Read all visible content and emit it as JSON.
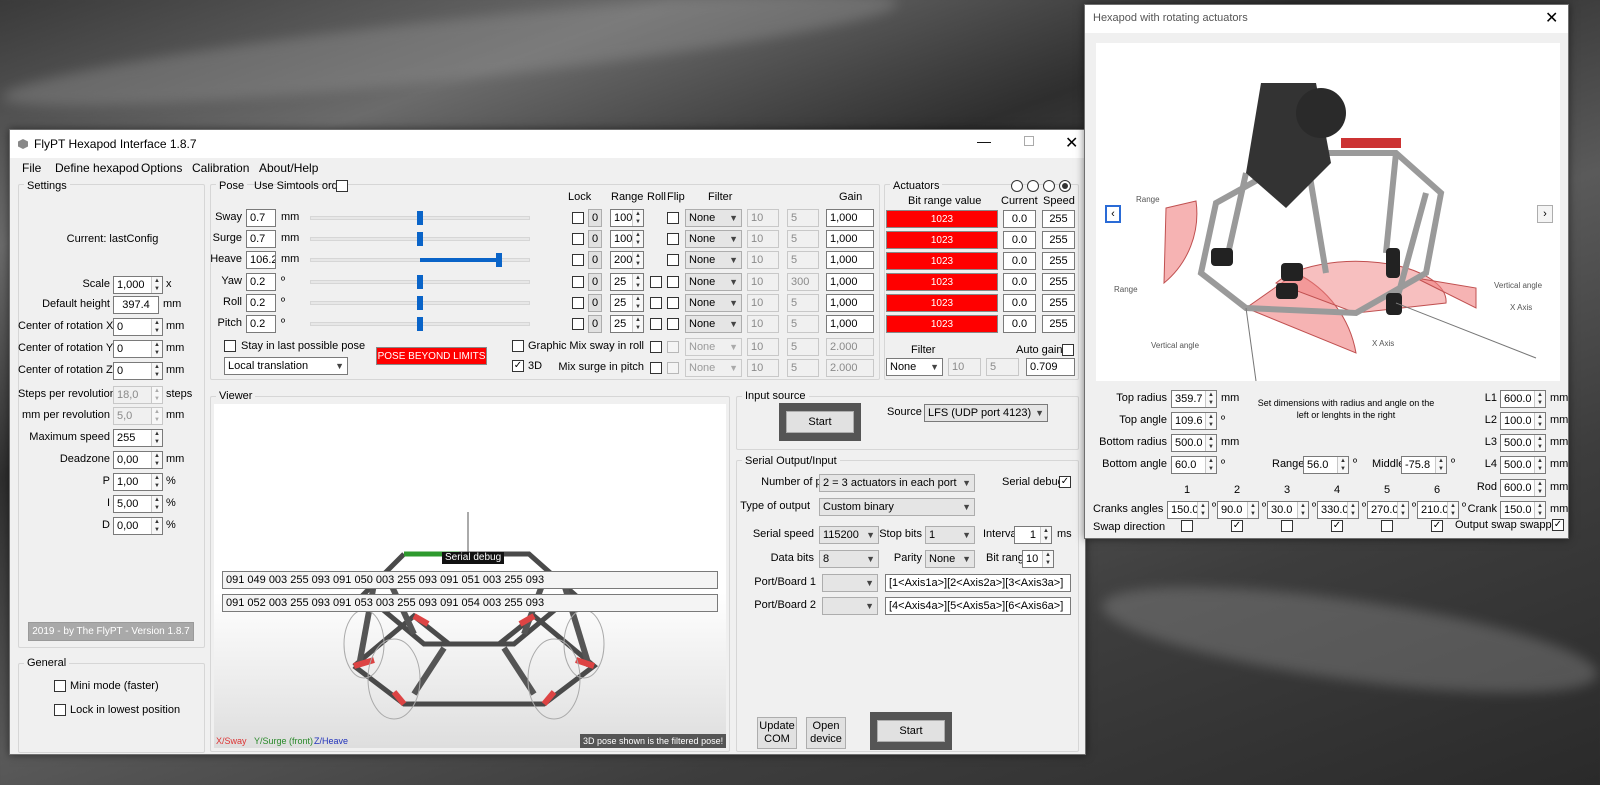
{
  "main_window": {
    "title": "FlyPT Hexapod Interface 1.8.7",
    "menu": [
      "File",
      "Define hexapod",
      "Options",
      "Calibration",
      "About/Help"
    ],
    "settings": {
      "group_label": "Settings",
      "current_config": "Current: lastConfig",
      "rows": [
        {
          "label": "Scale",
          "value": "1,000",
          "unit": "x",
          "spin": true,
          "disabled": false
        },
        {
          "label": "Default height",
          "value": "397.4",
          "unit": "mm",
          "spin": false,
          "disabled": false
        },
        {
          "label": "Center of rotation X",
          "value": "0",
          "unit": "mm",
          "spin": true,
          "disabled": false
        },
        {
          "label": "Center of rotation Y",
          "value": "0",
          "unit": "mm",
          "spin": true,
          "disabled": false
        },
        {
          "label": "Center of rotation Z",
          "value": "0",
          "unit": "mm",
          "spin": true,
          "disabled": false
        },
        {
          "label": "Steps per revolution",
          "value": "18,0",
          "unit": "steps",
          "spin": true,
          "disabled": true
        },
        {
          "label": "mm per revolution",
          "value": "5,0",
          "unit": "mm",
          "spin": true,
          "disabled": true
        },
        {
          "label": "Maximum speed",
          "value": "255",
          "unit": "",
          "spin": true,
          "disabled": false
        },
        {
          "label": "Deadzone",
          "value": "0,00",
          "unit": "mm",
          "spin": true,
          "disabled": false
        },
        {
          "label": "P",
          "value": "1,00",
          "unit": "%",
          "spin": true,
          "disabled": false
        },
        {
          "label": "I",
          "value": "5,00",
          "unit": "%",
          "spin": true,
          "disabled": false
        },
        {
          "label": "D",
          "value": "0,00",
          "unit": "%",
          "spin": true,
          "disabled": false
        }
      ],
      "version_button": "2019 - by The FlyPT - Version 1.8.7"
    },
    "general": {
      "group_label": "General",
      "mini_mode": "Mini mode (faster)",
      "lock_lowest": "Lock in lowest position"
    },
    "pose": {
      "group_label": "Pose",
      "simtools_label": "Use Simtools order",
      "headers": {
        "lock": "Lock",
        "range": "Range",
        "roll": "Roll",
        "flip": "Flip",
        "filter": "Filter",
        "gain": "Gain"
      },
      "rows": [
        {
          "name": "Sway",
          "value": "0.7",
          "unit": "mm",
          "slider_fraction": 0.5,
          "lock_value": "0",
          "range": "100",
          "roll": false,
          "filter": "None",
          "f1": "10",
          "f2": "5",
          "gain": "1,000"
        },
        {
          "name": "Surge",
          "value": "0.7",
          "unit": "mm",
          "slider_fraction": 0.5,
          "lock_value": "0",
          "range": "100",
          "roll": false,
          "filter": "None",
          "f1": "10",
          "f2": "5",
          "gain": "1,000"
        },
        {
          "name": "Heave",
          "value": "106.2",
          "unit": "mm",
          "slider_fraction": 0.86,
          "lock_value": "0",
          "range": "200",
          "roll": false,
          "filter": "None",
          "f1": "10",
          "f2": "5",
          "gain": "1,000"
        },
        {
          "name": "Yaw",
          "value": "0.2",
          "unit": "º",
          "slider_fraction": 0.5,
          "lock_value": "0",
          "range": "25",
          "roll": true,
          "filter": "None",
          "f1": "10",
          "f2": "300",
          "gain": "1,000"
        },
        {
          "name": "Roll",
          "value": "0.2",
          "unit": "º",
          "slider_fraction": 0.5,
          "lock_value": "0",
          "range": "25",
          "roll": true,
          "filter": "None",
          "f1": "10",
          "f2": "5",
          "gain": "1,000"
        },
        {
          "name": "Pitch",
          "value": "0.2",
          "unit": "º",
          "slider_fraction": 0.5,
          "lock_value": "0",
          "range": "25",
          "roll": true,
          "filter": "None",
          "f1": "10",
          "f2": "5",
          "gain": "1,000"
        }
      ],
      "stay_last_pose": "Stay in last possible pose",
      "pose_beyond": "POSE BEYOND LIMITS",
      "graphic": "Graphic",
      "three_d": "3D",
      "translation_mode": "Local translation",
      "mix_rows": [
        {
          "label": "Mix sway in roll",
          "filter": "None",
          "f1": "10",
          "f2": "5",
          "gain": "2.000"
        },
        {
          "label": "Mix surge in pitch",
          "filter": "None",
          "f1": "10",
          "f2": "5",
          "gain": "2.000"
        }
      ]
    },
    "actuators": {
      "group_label": "Actuators",
      "headers": {
        "bit_range": "Bit range value",
        "current": "Current",
        "speed": "Speed"
      },
      "rows": [
        {
          "bit": "1023",
          "current": "0.0",
          "speed": "255"
        },
        {
          "bit": "1023",
          "current": "0.0",
          "speed": "255"
        },
        {
          "bit": "1023",
          "current": "0.0",
          "speed": "255"
        },
        {
          "bit": "1023",
          "current": "0.0",
          "speed": "255"
        },
        {
          "bit": "1023",
          "current": "0.0",
          "speed": "255"
        },
        {
          "bit": "1023",
          "current": "0.0",
          "speed": "255"
        }
      ],
      "filter_label": "Filter",
      "filter_value": "None",
      "filter_f1": "10",
      "filter_f2": "5",
      "auto_gain": "Auto gain",
      "auto_gain_value": "0.709"
    },
    "viewer": {
      "group_label": "Viewer",
      "serial_debug_tag": "Serial debug",
      "debug_lines": [
        "091 049 003 255 093 091 050 003 255 093 091 051 003 255 093",
        "091 052 003 255 093 091 053 003 255 093 091 054 003 255 093"
      ],
      "legend_x": "X/Sway",
      "legend_y": "Y/Surge (front)",
      "legend_z": "Z/Heave",
      "note": "3D pose shown is the filtered pose!"
    },
    "input_source": {
      "group_label": "Input source",
      "start": "Start",
      "source_label": "Source",
      "source_value": "LFS (UDP port 4123)"
    },
    "serial": {
      "group_label": "Serial Output/Input",
      "ports_label": "Number of ports",
      "ports_value": "2 = 3 actuators in each port",
      "serial_debug": "Serial debug",
      "output_label": "Type of output",
      "output_value": "Custom binary",
      "speed_label": "Serial speed",
      "speed_value": "115200",
      "stopbits_label": "Stop bits",
      "stopbits_value": "1",
      "interval_label": "Interval",
      "interval_value": "1",
      "interval_unit": "ms",
      "databits_label": "Data bits",
      "databits_value": "8",
      "parity_label": "Parity",
      "parity_value": "None",
      "bitrange_label": "Bit range",
      "bitrange_value": "10",
      "port1_label": "Port/Board 1",
      "port1_string": "[1<Axis1a>][2<Axis2a>][3<Axis3a>]",
      "port2_label": "Port/Board 2",
      "port2_string": "[4<Axis4a>][5<Axis5a>][6<Axis6a>]",
      "update_com": "Update COM",
      "open_device": "Open device",
      "start": "Start"
    }
  },
  "side_window": {
    "title": "Hexapod with rotating actuators",
    "diagram_labels": {
      "range_top": "Range",
      "range_left": "Range",
      "vertical_angle_left": "Vertical angle",
      "vertical_angle_right": "Vertical angle",
      "x_axis_right": "X Axis",
      "x_axis_mid": "X Axis"
    },
    "note": "Set dimensions with radius and angle on the left or lenghts in the right",
    "left_fields": [
      {
        "label": "Top radius",
        "value": "359.7",
        "unit": "mm"
      },
      {
        "label": "Top angle",
        "value": "109.6",
        "unit": "º"
      },
      {
        "label": "Bottom radius",
        "value": "500.0",
        "unit": "mm"
      },
      {
        "label": "Bottom angle",
        "value": "60.0",
        "unit": "º"
      }
    ],
    "range_label": "Range",
    "range_value": "56.0",
    "range_unit": "º",
    "middle_label": "Middle",
    "middle_value": "-75.8",
    "middle_unit": "º",
    "right_fields": [
      {
        "label": "L1",
        "value": "600.0",
        "unit": "mm"
      },
      {
        "label": "L2",
        "value": "100.0",
        "unit": "mm"
      },
      {
        "label": "L3",
        "value": "500.0",
        "unit": "mm"
      },
      {
        "label": "L4",
        "value": "500.0",
        "unit": "mm"
      },
      {
        "label": "Rod",
        "value": "600.0",
        "unit": "mm"
      },
      {
        "label": "Crank",
        "value": "150.0",
        "unit": "mm"
      }
    ],
    "crank_headers": [
      "1",
      "2",
      "3",
      "4",
      "5",
      "6"
    ],
    "cranks_label": "Cranks angles",
    "crank_values": [
      "150.0",
      "90.0",
      "30.0",
      "330.0",
      "270.0",
      "210.0"
    ],
    "crank_unit": "º",
    "swap_label": "Swap direction",
    "swap_states": [
      false,
      true,
      false,
      true,
      false,
      true
    ],
    "output_swap": "Output swap swapped"
  }
}
